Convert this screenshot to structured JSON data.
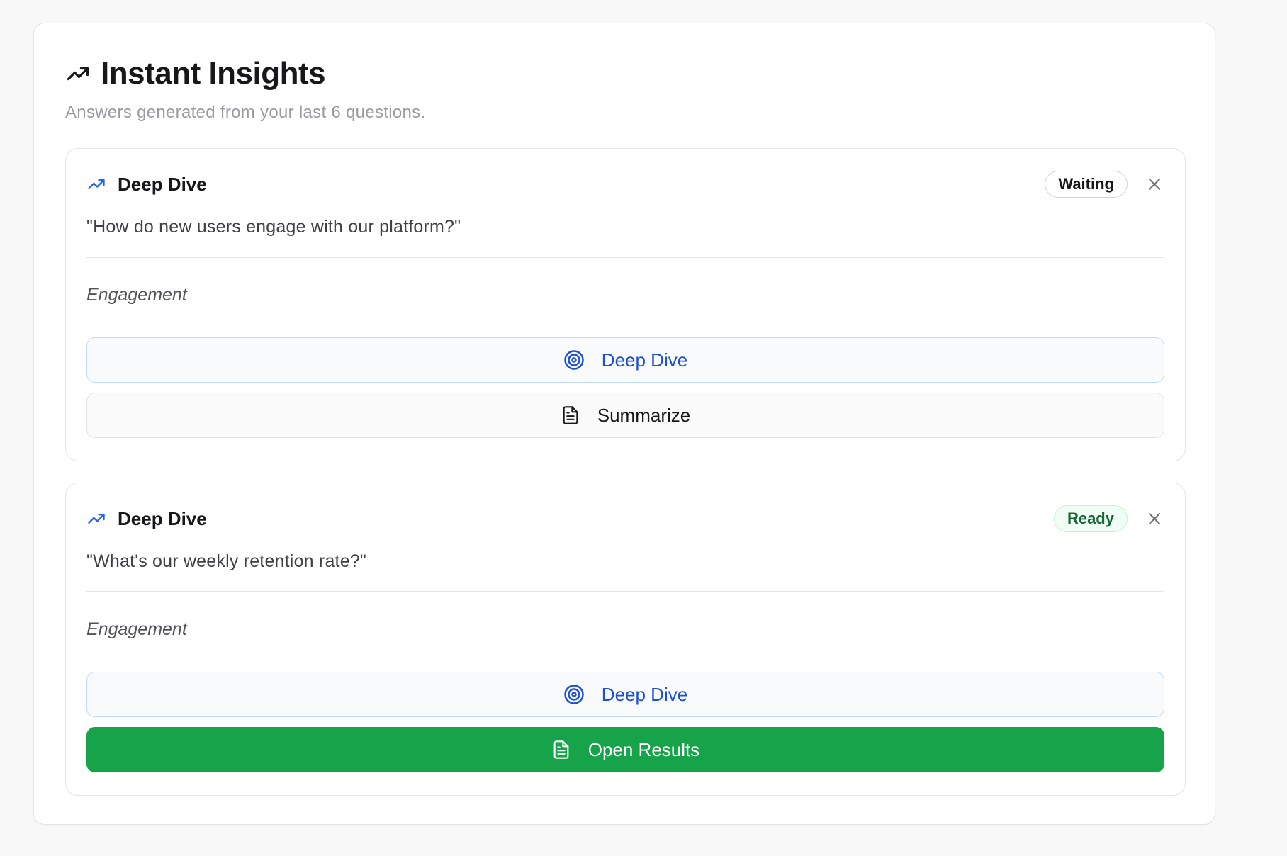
{
  "panel": {
    "title": "Instant Insights",
    "subtitle": "Answers generated from your last 6 questions.",
    "title_icon": "trending-up-icon"
  },
  "cards": [
    {
      "kind": "Deep Dive",
      "kind_icon": "trending-up-icon",
      "status": "Waiting",
      "question": "\"How do new users engage with our platform?\"",
      "category": "Engagement",
      "primary_action": {
        "label": "Deep Dive",
        "icon": "target-icon"
      },
      "secondary_action": {
        "label": "Summarize",
        "icon": "document-icon"
      }
    },
    {
      "kind": "Deep Dive",
      "kind_icon": "trending-up-icon",
      "status": "Ready",
      "question": "\"What's our weekly retention rate?\"",
      "category": "Engagement",
      "primary_action": {
        "label": "Deep Dive",
        "icon": "target-icon"
      },
      "secondary_action": {
        "label": "Open Results",
        "icon": "document-icon"
      }
    }
  ],
  "colors": {
    "accent_blue": "#1d4ed8",
    "success_green": "#16a34a",
    "ready_text": "#166534"
  }
}
